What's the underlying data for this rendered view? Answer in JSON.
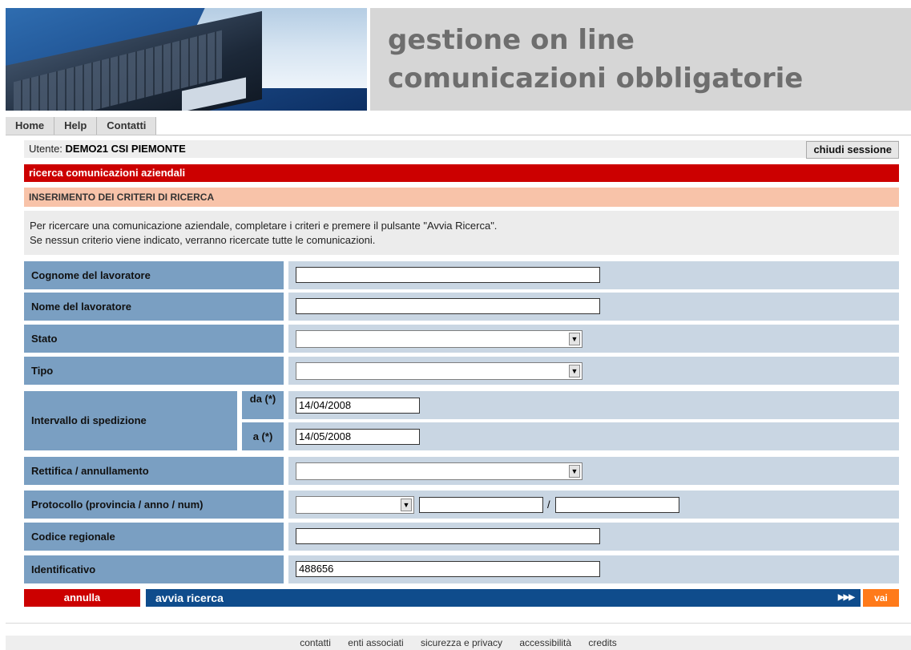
{
  "header": {
    "title_line1": "gestione on line",
    "title_line2": "comunicazioni obbligatorie"
  },
  "nav": {
    "tabs": [
      "Home",
      "Help",
      "Contatti"
    ]
  },
  "user": {
    "label": "Utente:",
    "name": "DEMO21 CSI PIEMONTE",
    "logout_label": "chiudi sessione"
  },
  "section": {
    "title": "ricerca comunicazioni aziendali",
    "subtitle": "INSERIMENTO DEI CRITERI DI RICERCA",
    "intro_line1": "Per ricercare una comunicazione aziendale, completare i criteri e premere il pulsante \"Avvia Ricerca\".",
    "intro_line2": "Se nessun criterio viene indicato, verranno ricercate tutte le comunicazioni."
  },
  "form": {
    "cognome_label": "Cognome del lavoratore",
    "cognome_value": "",
    "nome_label": "Nome del lavoratore",
    "nome_value": "",
    "stato_label": "Stato",
    "stato_value": "",
    "tipo_label": "Tipo",
    "tipo_value": "",
    "intervallo_label": "Intervallo di spedizione",
    "da_label": "da (*)",
    "da_value": "14/04/2008",
    "a_label": "a (*)",
    "a_value": "14/05/2008",
    "rettifica_label": "Rettifica / annullamento",
    "rettifica_value": "",
    "protocollo_label": "Protocollo (provincia / anno / num)",
    "protocollo_provincia": "",
    "protocollo_anno": "",
    "protocollo_sep": "/",
    "protocollo_num": "",
    "codice_label": "Codice regionale",
    "codice_value": "",
    "identificativo_label": "Identificativo",
    "identificativo_value": "488656"
  },
  "actions": {
    "annulla_label": "annulla",
    "avvia_label": "avvia ricerca",
    "arrows": "▶▶▶",
    "vai_label": "vai"
  },
  "footer": {
    "links": [
      "contatti",
      "enti associati",
      "sicurezza e privacy",
      "accessibilità",
      "credits"
    ]
  },
  "colors": {
    "red": "#cc0000",
    "salmon": "#f8c3a9",
    "label_blue": "#7a9fc2",
    "field_blue": "#c9d6e3",
    "action_blue": "#0f4c8c",
    "orange": "#ff7a1a"
  }
}
